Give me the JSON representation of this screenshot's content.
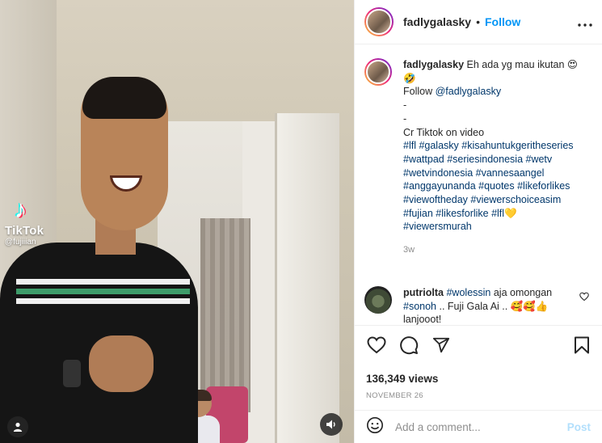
{
  "media": {
    "watermark_brand": "TikTok",
    "watermark_handle": "@fujiiian"
  },
  "header": {
    "username": "fadlygalasky",
    "separator": "•",
    "follow_label": "Follow",
    "more_icon": "more-horizontal-icon"
  },
  "caption": {
    "username": "fadlygalasky",
    "line1": "Eh ada yg mau ikutan 😍",
    "line2": "🤣",
    "follow_prefix": "Follow ",
    "follow_mention": "@fadlygalasky",
    "dash1": "-",
    "dash2": "-",
    "credit": "Cr Tiktok on video",
    "hashtags_1": "#lfl #galasky #kisahuntukgeritheseries #wattpad #seriesindonesia #wetv #wetvindonesia #vannesaangel #anggayunanda #quotes #likeforlikes #viewoftheday #viewerschoiceasim #fujian #likesforlike #lfl",
    "heart_emoji": "💛",
    "hashtags_2": "#viewersmurah",
    "age": "3w"
  },
  "reply": {
    "username": "putriolta",
    "tag1": "#wolessin",
    "text1": " aja omongan",
    "tag2": "#sonoh",
    "text2": " .. Fuji Gala Ai .. 🥰🥰👍",
    "text3": "lanjooot!"
  },
  "actions": {
    "icons": [
      "heart-icon",
      "comment-icon",
      "share-icon",
      "bookmark-icon"
    ],
    "views": "136,349 views",
    "date": "NOVEMBER 26"
  },
  "composer": {
    "placeholder": "Add a comment...",
    "post_label": "Post",
    "post_color": "#b2dffc"
  },
  "colors": {
    "accent": "#0095f6",
    "link": "#00376b",
    "muted": "#8e8e8e"
  }
}
